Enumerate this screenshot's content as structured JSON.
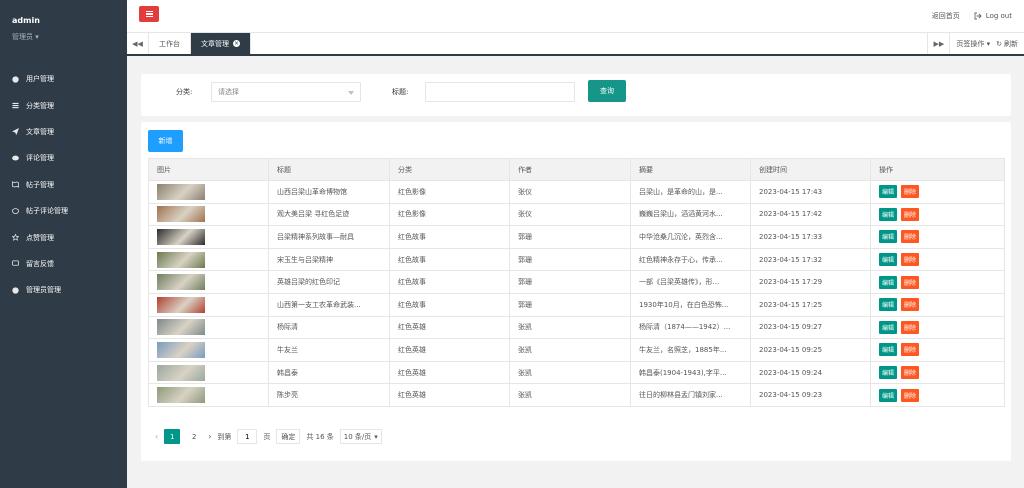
{
  "sidebar": {
    "user_name": "admin",
    "user_role": "管理员 ▾",
    "items": [
      {
        "label": "用户管理",
        "icon": "user-circle-icon"
      },
      {
        "label": "分类管理",
        "icon": "list-icon"
      },
      {
        "label": "文章管理",
        "icon": "send-icon"
      },
      {
        "label": "评论管理",
        "icon": "comments-icon"
      },
      {
        "label": "帖子管理",
        "icon": "map-icon"
      },
      {
        "label": "帖子评论管理",
        "icon": "comment-icon"
      },
      {
        "label": "点赞管理",
        "icon": "star-icon"
      },
      {
        "label": "留言反馈",
        "icon": "chat-icon"
      },
      {
        "label": "管理员管理",
        "icon": "user-circle-icon"
      }
    ]
  },
  "header": {
    "home_link": "返回首页",
    "logout": "Log out"
  },
  "tabs": {
    "items": [
      {
        "label": "工作台"
      },
      {
        "label": "文章管理"
      }
    ],
    "page_ops": "页签操作 ▾",
    "refresh": "刷新"
  },
  "search": {
    "category_label": "分类:",
    "category_placeholder": "请选择",
    "title_label": "标题:",
    "title_value": "",
    "query_button": "查询"
  },
  "list": {
    "add_button": "新增",
    "columns": [
      "图片",
      "标题",
      "分类",
      "作者",
      "摘要",
      "创建时间",
      "操作"
    ],
    "edit_label": "编辑",
    "delete_label": "删除",
    "rows": [
      {
        "title": "山西吕梁山革命博物馆",
        "category": "红色影像",
        "author": "张仪",
        "summary": "吕梁山，是革命的山，是...",
        "created": "2023-04-15 17:43",
        "thumb": "#8a8070"
      },
      {
        "title": "观大美吕梁 寻红色足迹",
        "category": "红色影像",
        "author": "张仪",
        "summary": "巍巍吕梁山，滔滔黄河水...",
        "created": "2023-04-15 17:42",
        "thumb": "#a0724f"
      },
      {
        "title": "吕梁精神系列故事—耐具",
        "category": "红色故事",
        "author": "郭珊",
        "summary": "中华沧桑几沉沦，英烈含...",
        "created": "2023-04-15 17:33",
        "thumb": "#2b2b2b"
      },
      {
        "title": "宋玉生与吕梁精神",
        "category": "红色故事",
        "author": "郭珊",
        "summary": "红色精神永存于心，传承...",
        "created": "2023-04-15 17:32",
        "thumb": "#6a7a50"
      },
      {
        "title": "英雄吕梁的红色印记",
        "category": "红色故事",
        "author": "郭珊",
        "summary": "一部《吕梁英雄传》，形...",
        "created": "2023-04-15 17:29",
        "thumb": "#6f7f5f"
      },
      {
        "title": "山西第一支工农革命武装...",
        "category": "红色故事",
        "author": "郭珊",
        "summary": "1930年10月，在白色恐怖...",
        "created": "2023-04-15 17:25",
        "thumb": "#b04030"
      },
      {
        "title": "杨际清",
        "category": "红色英雄",
        "author": "张凯",
        "summary": "杨际清（1874——1942）...",
        "created": "2023-04-15 09:27",
        "thumb": "#7e8a8c"
      },
      {
        "title": "牛友兰",
        "category": "红色英雄",
        "author": "张凯",
        "summary": "牛友兰，名照芝，1885年...",
        "created": "2023-04-15 09:25",
        "thumb": "#7a9abf"
      },
      {
        "title": "韩昌泰",
        "category": "红色英雄",
        "author": "张凯",
        "summary": "韩昌泰(1904-1943),字平...",
        "created": "2023-04-15 09:24",
        "thumb": "#9aa8a0"
      },
      {
        "title": "陈步亮",
        "category": "红色英雄",
        "author": "张凯",
        "summary": "往日的柳林县孟门镇刘家...",
        "created": "2023-04-15 09:23",
        "thumb": "#8c9a7a"
      }
    ]
  },
  "pager": {
    "pages": [
      "1",
      "2"
    ],
    "goto_label": "到第",
    "goto_value": "1",
    "page_unit": "页",
    "confirm": "确定",
    "total": "共 16 条",
    "page_size": "10 条/页"
  }
}
